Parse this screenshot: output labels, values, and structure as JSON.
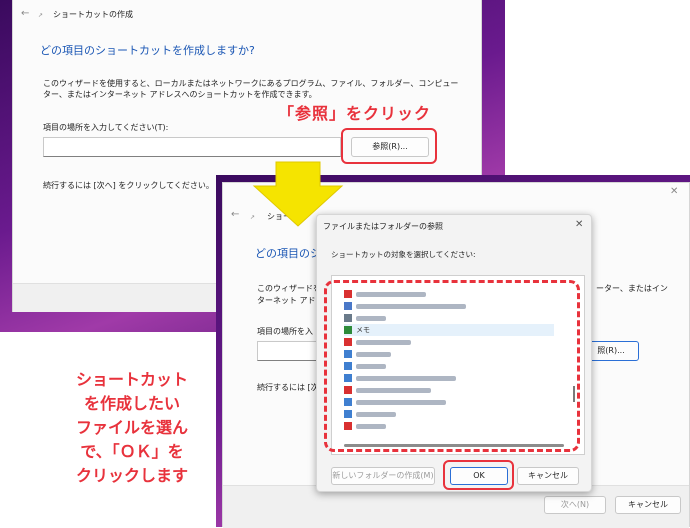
{
  "back_window": {
    "title": "ショートカットの作成",
    "heading": "どの項目のショートカットを作成しますか?",
    "description": "このウィザードを使用すると、ローカルまたはネットワークにあるプログラム、ファイル、フォルダー、コンピューター、またはインターネット アドレスへのショートカットを作成できます。",
    "field_label": "項目の場所を入力してください(T):",
    "browse_label": "参照(R)...",
    "footer_note": "続行するには [次へ] をクリックしてください。"
  },
  "front_window": {
    "title": "ショートカ",
    "heading": "どの項目のシ",
    "desc_left": "このウィザードを使\nターネット アドレス",
    "desc_right": "ーター、またはイン",
    "field_label": "項目の場所を入",
    "browse_label": "照(R)...",
    "footer_note": "続行するには [次",
    "next_label": "次へ(N)",
    "cancel_label": "キャンセル"
  },
  "dialog": {
    "title": "ファイルまたはフォルダーの参照",
    "instruction": "ショートカットの対象を選択してください:",
    "selected_item": "メモ",
    "new_folder_label": "新しいフォルダーの作成(M)",
    "ok_label": "OK",
    "cancel_label": "キャンセル",
    "icon_colors": [
      "#d93030",
      "#4a78c8",
      "#6a7a8a",
      "#2e8b3a",
      "#d93030",
      "#3f7fd0",
      "#3f7fd0",
      "#3f7fd0",
      "#d93030",
      "#3f7fd0",
      "#3f7fd0",
      "#d93030"
    ]
  },
  "annotations": {
    "browse_callout": "「参照」をクリック",
    "instruction_callout": "ショートカット\nを作成したい\nファイルを選ん\nで、「ＯＫ」を\nクリックします"
  },
  "colors": {
    "annotation_red": "#e8323c",
    "arrow_yellow": "#f5e400",
    "heading_blue": "#1a56b4"
  }
}
